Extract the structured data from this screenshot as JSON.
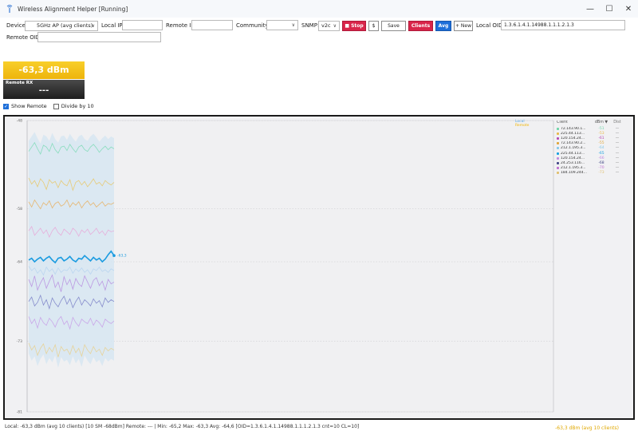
{
  "window": {
    "title": "Wireless Alignment Helper [Running]",
    "minimize": "—",
    "maximize": "☐",
    "close": "✕"
  },
  "toolbar": {
    "device_label": "Device:",
    "device_value": "5GHz AP (avg clients)",
    "local_ip_label": "Local IP:",
    "local_ip_value": "",
    "remote_ip_label": "Remote IP:",
    "remote_ip_value": "",
    "community_label": "Community:",
    "community_value": "",
    "snmp_label": "SNMP:",
    "snmp_value": "v2c",
    "stop_label": "■ Stop",
    "dollar_label": "$",
    "save_label": "Save",
    "clients_label": "Clients ◆",
    "avg_label": "Avg",
    "new_label": "+ New",
    "local_oid_label": "Local OID:",
    "local_oid_value": "1.3.6.1.4.1.14988.1.1.1.2.1.3",
    "remote_oid_label": "Remote OID:",
    "remote_oid_value": ""
  },
  "status_tiles": {
    "local_value": "-63,3 dBm",
    "remote_title": "Remote RX",
    "remote_value": "---"
  },
  "options": {
    "show_remote": "Show Remote",
    "show_remote_checked": true,
    "divide_by_10": "Divide by 10",
    "divide_by_10_checked": false
  },
  "chart_data": {
    "type": "line",
    "y_ticks": [
      "-48",
      "-58",
      "-64",
      "-73",
      "-81"
    ],
    "ylim": [
      -81,
      -48
    ],
    "current_label": "-63,3",
    "series_key": [
      {
        "name": "Local",
        "color": "#5aaae8"
      },
      {
        "name": "Remote",
        "color": "#f0b400"
      }
    ],
    "table_headers": [
      "Client",
      "dBm ▼",
      "Dist"
    ],
    "clients": [
      {
        "name": "72.143.90.1...",
        "dbm": "-51",
        "dist": "—",
        "color": "#6fd4a8"
      },
      {
        "name": "225.44.113...",
        "dbm": "-53",
        "dist": "—",
        "color": "#e8b84a"
      },
      {
        "name": "120.154.24...",
        "dbm": "-61",
        "dist": "—",
        "color": "#b44ab4"
      },
      {
        "name": "72.143.90.2...",
        "dbm": "-55",
        "dist": "—",
        "color": "#e0a63a"
      },
      {
        "name": "212.1.195.3...",
        "dbm": "-64",
        "dist": "—",
        "color": "#86c8e8"
      },
      {
        "name": "225.44.113...",
        "dbm": "-65",
        "dist": "—",
        "color": "#1aa0e0"
      },
      {
        "name": "120.154.24...",
        "dbm": "-66",
        "dist": "—",
        "color": "#c08ae0"
      },
      {
        "name": "24.253.116...",
        "dbm": "-68",
        "dist": "—",
        "color": "#444a88"
      },
      {
        "name": "212.1.195.3...",
        "dbm": "-70",
        "dist": "—",
        "color": "#c070d0"
      },
      {
        "name": "184.109.244...",
        "dbm": "-73",
        "dist": "—",
        "color": "#e0c070"
      }
    ],
    "series": [
      {
        "name": "avg",
        "color": "#1a9be0",
        "values": [
          -63.8,
          -63.6,
          -64.0,
          -63.7,
          -63.5,
          -63.9,
          -63.6,
          -63.4,
          -63.8,
          -64.1,
          -63.6,
          -63.5,
          -63.9,
          -63.7,
          -63.4,
          -63.8,
          -64.0,
          -63.6,
          -63.7,
          -63.3,
          -63.6,
          -63.9,
          -63.5,
          -63.8,
          -63.6,
          -64.0,
          -63.7,
          -63.2,
          -62.8,
          -63.3
        ]
      },
      {
        "name": "c1",
        "color": "#7fdcb8",
        "values": [
          -51.5,
          -51,
          -50.5,
          -51.2,
          -51.8,
          -50.8,
          -51,
          -51.5,
          -50.6,
          -51.3,
          -51.7,
          -51,
          -50.9,
          -51.4,
          -50.7,
          -51.2,
          -51.6,
          -51,
          -50.8,
          -51.3,
          -51.5,
          -51,
          -50.7,
          -51.1,
          -51.6,
          -51.2,
          -50.9,
          -51.3,
          -51,
          -51.2
        ]
      },
      {
        "name": "c2",
        "color": "#e8c86a",
        "values": [
          -54.5,
          -55.2,
          -54.8,
          -55.5,
          -54.6,
          -55,
          -55.8,
          -54.7,
          -55.1,
          -54.9,
          -55.6,
          -54.8,
          -55.2,
          -55.4,
          -54.7,
          -55.9,
          -55,
          -54.8,
          -55.3,
          -54.9,
          -55.5,
          -55.1,
          -54.6,
          -55.2,
          -55,
          -55.4,
          -54.8,
          -55.1,
          -55.3,
          -55
        ]
      },
      {
        "name": "c3",
        "color": "#e8a8d8",
        "values": [
          -60.5,
          -60,
          -61,
          -60.6,
          -60.2,
          -60.8,
          -60.4,
          -61.2,
          -60.5,
          -60.1,
          -60.7,
          -61,
          -60.3,
          -60.6,
          -60.9,
          -60.2,
          -60.5,
          -61.1,
          -60.4,
          -60.7,
          -60.3,
          -60.9,
          -60.6,
          -60.2,
          -60.8,
          -60.5,
          -61,
          -60.4,
          -60.6,
          -60.5
        ]
      },
      {
        "name": "c4",
        "color": "#e8b060",
        "values": [
          -57.2,
          -57.8,
          -57,
          -57.5,
          -58,
          -57.3,
          -57.6,
          -57.1,
          -57.9,
          -57.4,
          -57.2,
          -57.7,
          -57.5,
          -57,
          -57.8,
          -57.3,
          -57.6,
          -57.2,
          -57.9,
          -57.4,
          -57.1,
          -57.6,
          -57.3,
          -57.8,
          -57.5,
          -57.2,
          -57.7,
          -57.4,
          -57.5,
          -57.3
        ]
      },
      {
        "name": "c5",
        "color": "#b8d4f0",
        "values": [
          -64.5,
          -65,
          -64.7,
          -65.3,
          -64.9,
          -65.5,
          -64.6,
          -65.1,
          -64.8,
          -65.4,
          -64.7,
          -65.2,
          -64.9,
          -65,
          -64.6,
          -65.3,
          -64.8,
          -65.1,
          -64.7,
          -65.2,
          -64.9,
          -65.4,
          -64.8,
          -65,
          -64.6,
          -65.1,
          -64.9,
          -65.2,
          -64.8,
          -65
        ]
      },
      {
        "name": "c6",
        "color": "#b890e0",
        "values": [
          -66,
          -66.8,
          -65.6,
          -67.2,
          -66.4,
          -65.8,
          -67,
          -66.2,
          -65.5,
          -66.9,
          -66.3,
          -67.4,
          -65.7,
          -66.6,
          -66,
          -67.1,
          -65.9,
          -66.5,
          -66.8,
          -65.6,
          -66.3,
          -67,
          -66.1,
          -65.8,
          -66.7,
          -66.2,
          -67.2,
          -66,
          -66.5,
          -66.3
        ]
      },
      {
        "name": "c7",
        "color": "#7c82c8",
        "values": [
          -68.5,
          -68,
          -69,
          -68.6,
          -67.8,
          -68.9,
          -68.3,
          -69.3,
          -68.1,
          -68.7,
          -69.1,
          -68.4,
          -67.9,
          -68.8,
          -68.2,
          -69.2,
          -68.5,
          -68,
          -68.9,
          -68.3,
          -68.6,
          -69,
          -68.2,
          -68.7,
          -68.4,
          -69.1,
          -68.1,
          -68.6,
          -68.3,
          -68.5
        ]
      },
      {
        "name": "c8",
        "color": "#c8a0e8",
        "values": [
          -70.2,
          -71,
          -70.5,
          -71.5,
          -70.3,
          -70.9,
          -71.2,
          -70.4,
          -70.8,
          -71.4,
          -70.6,
          -70.2,
          -71.1,
          -70.7,
          -71.6,
          -70.3,
          -70.9,
          -71.3,
          -70.5,
          -70.8,
          -71,
          -70.4,
          -71.2,
          -70.6,
          -70.9,
          -71.4,
          -70.5,
          -70.8,
          -71,
          -70.7
        ]
      },
      {
        "name": "c9",
        "color": "#e8d090",
        "values": [
          -73.2,
          -74,
          -73.5,
          -74.6,
          -73.8,
          -73.3,
          -74.4,
          -73.7,
          -74.2,
          -73.4,
          -74.8,
          -73.6,
          -74.1,
          -73.9,
          -74.5,
          -73.5,
          -74.3,
          -73.8,
          -74.7,
          -73.4,
          -74,
          -74.4,
          -73.6,
          -74.2,
          -73.9,
          -74.6,
          -73.7,
          -74.1,
          -73.8,
          -74
        ]
      }
    ]
  },
  "statusbar": {
    "text": "Local: -63,3 dBm (avg 10 clients) [10 SM -68dBm]  Remote: ---  |  Min: -65,2  Max: -63,3  Avg: -64,6  [OID=1.3.6.1.4.1.14988.1.1.1.2.1.3 cnt=10 CL=10]",
    "right": "-63,3 dBm (avg 10 clients)"
  }
}
